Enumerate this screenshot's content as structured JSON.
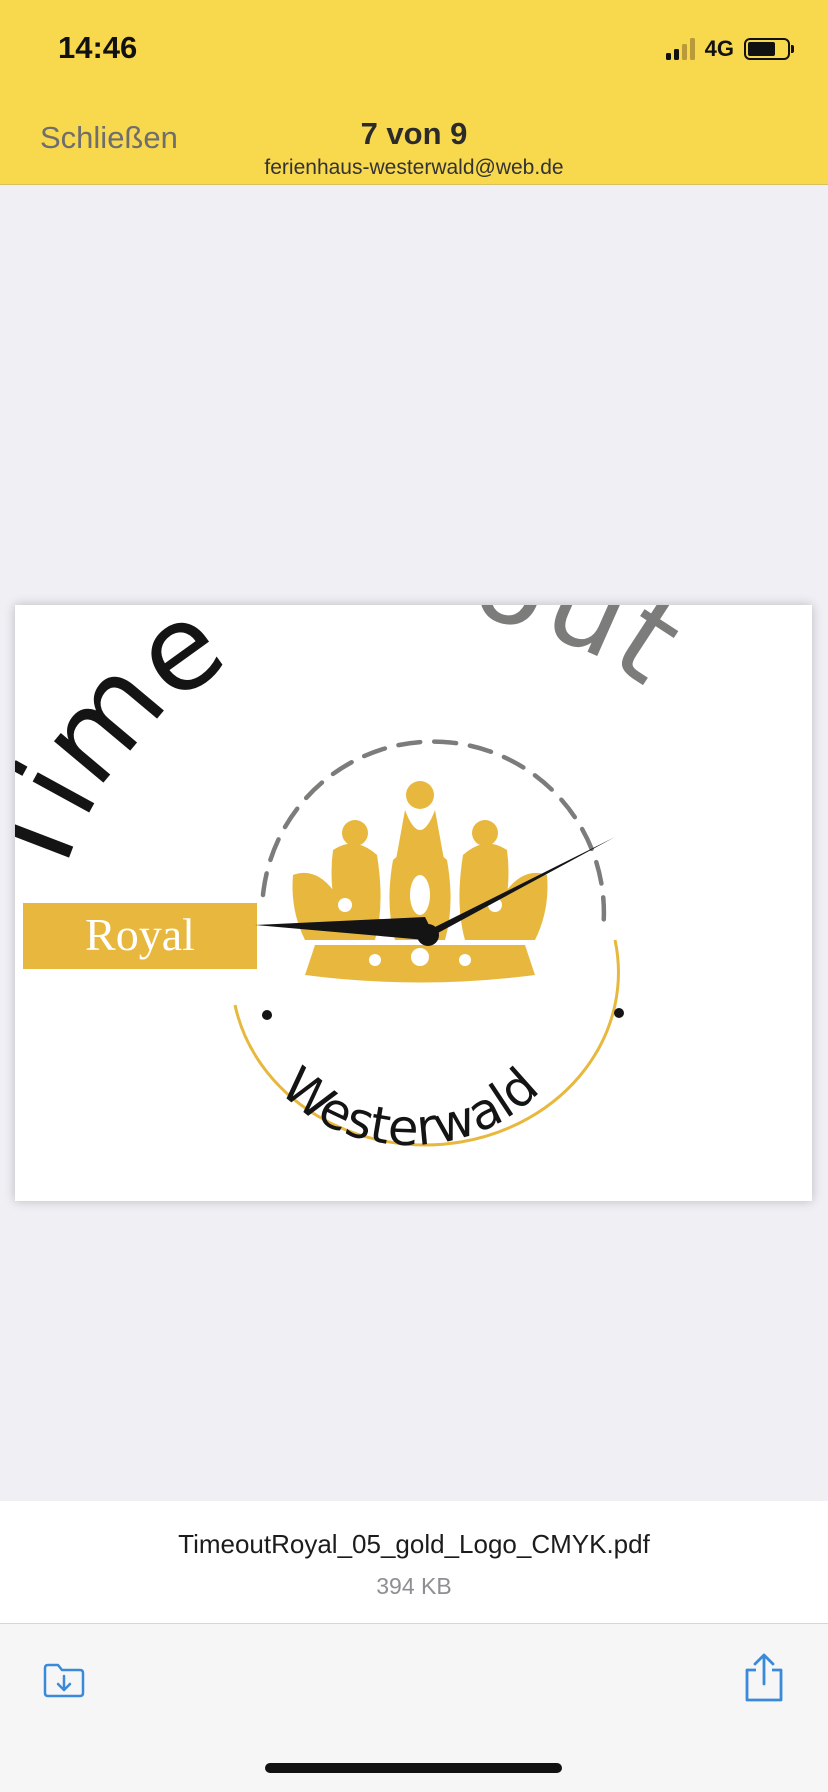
{
  "status_bar": {
    "time": "14:46",
    "network": "4G",
    "battery_level": 0.7,
    "signal_bars_active": 2,
    "signal_bars_total": 4
  },
  "header": {
    "close_label": "Schließen",
    "page_counter": "7 von 9",
    "sender": "ferienhaus-westerwald@web.de",
    "background_color": "#f8d84c"
  },
  "document": {
    "logo_text": {
      "time": "Time",
      "out": "out",
      "royal": "Royal",
      "region": "Westerwald"
    },
    "colors": {
      "gold": "#e8b83e",
      "grey": "#7c7d7b",
      "black": "#141414"
    }
  },
  "file": {
    "name": "TimeoutRoyal_05_gold_Logo_CMYK.pdf",
    "size": "394 KB"
  },
  "toolbar": {
    "save_icon": "save-to-files-icon",
    "share_icon": "share-icon",
    "accent_color": "#3b8ad9"
  }
}
